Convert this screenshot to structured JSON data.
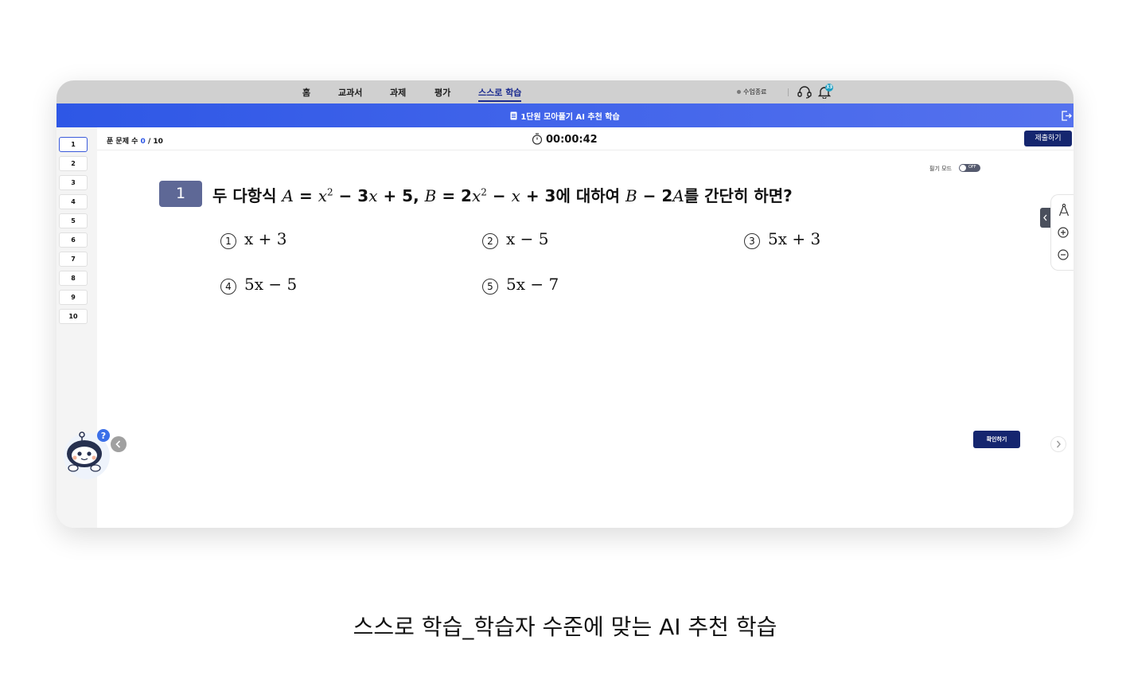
{
  "nav": {
    "items": [
      "홈",
      "교과서",
      "과제",
      "평가",
      "스스로 학습"
    ],
    "active_index": 4,
    "class_end": "수업종료",
    "notification_count": "33"
  },
  "banner": {
    "title": "1단원 모아풀기 AI 추천 학습"
  },
  "sidebar": {
    "questions": [
      "1",
      "2",
      "3",
      "4",
      "5",
      "6",
      "7",
      "8",
      "9",
      "10"
    ],
    "active": "1"
  },
  "toolbar": {
    "solved_label": "푼 문제 수",
    "solved_count": "0",
    "total": "/ 10",
    "timer": "00:00:42",
    "submit_label": "제출하기"
  },
  "handwriting": {
    "label": "필기 모드",
    "state": "OFF"
  },
  "question": {
    "number": "1",
    "prefix": "두 다항식",
    "join1": "에 대하여",
    "suffix": "를 간단히 하면?",
    "choices": [
      {
        "mark": "1",
        "expr": "x + 3"
      },
      {
        "mark": "2",
        "expr": "x − 5"
      },
      {
        "mark": "3",
        "expr": "5x + 3"
      },
      {
        "mark": "4",
        "expr": "5x − 5"
      },
      {
        "mark": "5",
        "expr": "5x − 7"
      }
    ]
  },
  "actions": {
    "confirm_label": "확인하기"
  },
  "caption": "스스로 학습_학습자 수준에 맞는 AI 추천 학습",
  "colors": {
    "brand_navy": "#15266f",
    "banner_blue": "#2e57e6",
    "question_badge": "#5e6896"
  },
  "icons": [
    "document-icon",
    "exit-icon",
    "timer-icon",
    "support-headset-icon",
    "bell-icon",
    "compass-icon",
    "zoom-in-icon",
    "zoom-out-icon",
    "chevron-left-icon",
    "chevron-right-icon",
    "robot-mascot-icon",
    "help-icon"
  ]
}
